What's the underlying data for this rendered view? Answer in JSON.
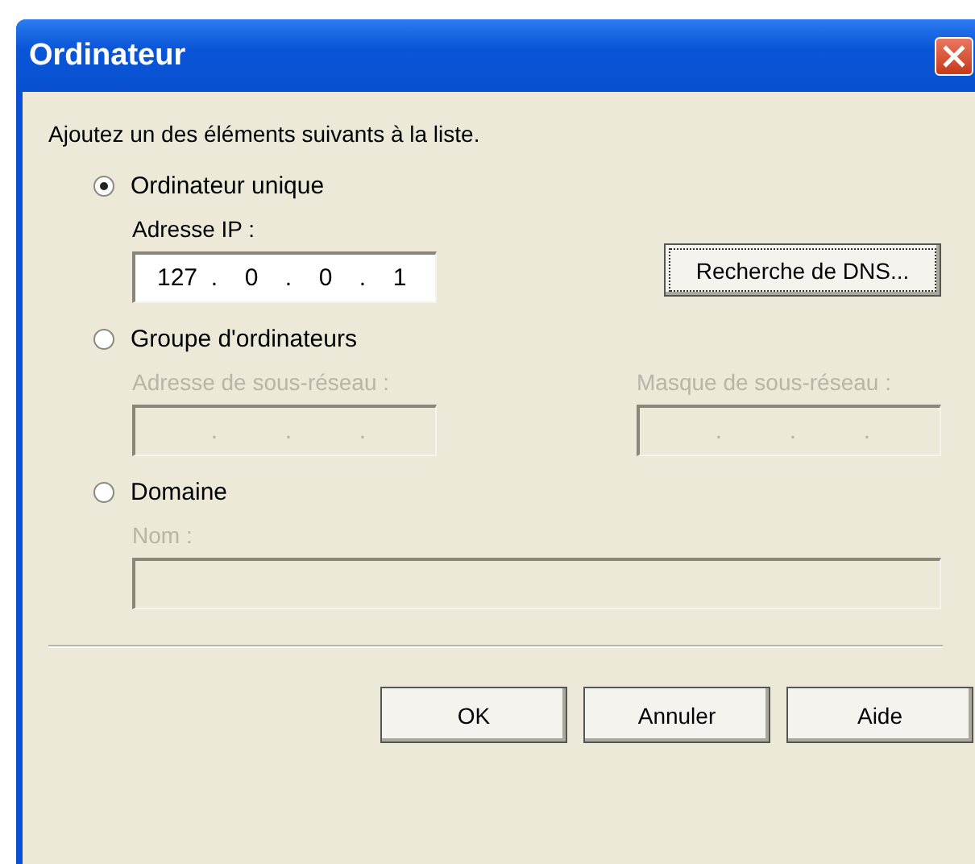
{
  "window": {
    "title": "Ordinateur"
  },
  "instruction": "Ajoutez un des éléments suivants à la liste.",
  "options": [
    {
      "label": "Ordinateur unique",
      "selected": true,
      "fields": [
        {
          "kind": "ip",
          "label": "Adresse IP :",
          "disabled": false,
          "separator": ".",
          "octets": [
            "127",
            "0",
            "0",
            "1"
          ]
        }
      ],
      "button": "Recherche de DNS..."
    },
    {
      "label": "Groupe d'ordinateurs",
      "selected": false,
      "fields": [
        {
          "kind": "ip",
          "label": "Adresse de sous-réseau :",
          "disabled": true,
          "separator": "."
        },
        {
          "kind": "ip",
          "label": "Masque de sous-réseau :",
          "disabled": true,
          "separator": "."
        }
      ]
    },
    {
      "label": "Domaine",
      "selected": false,
      "fields": [
        {
          "kind": "text",
          "label": "Nom :",
          "disabled": true
        }
      ]
    }
  ],
  "buttons": [
    "OK",
    "Annuler",
    "Aide"
  ]
}
